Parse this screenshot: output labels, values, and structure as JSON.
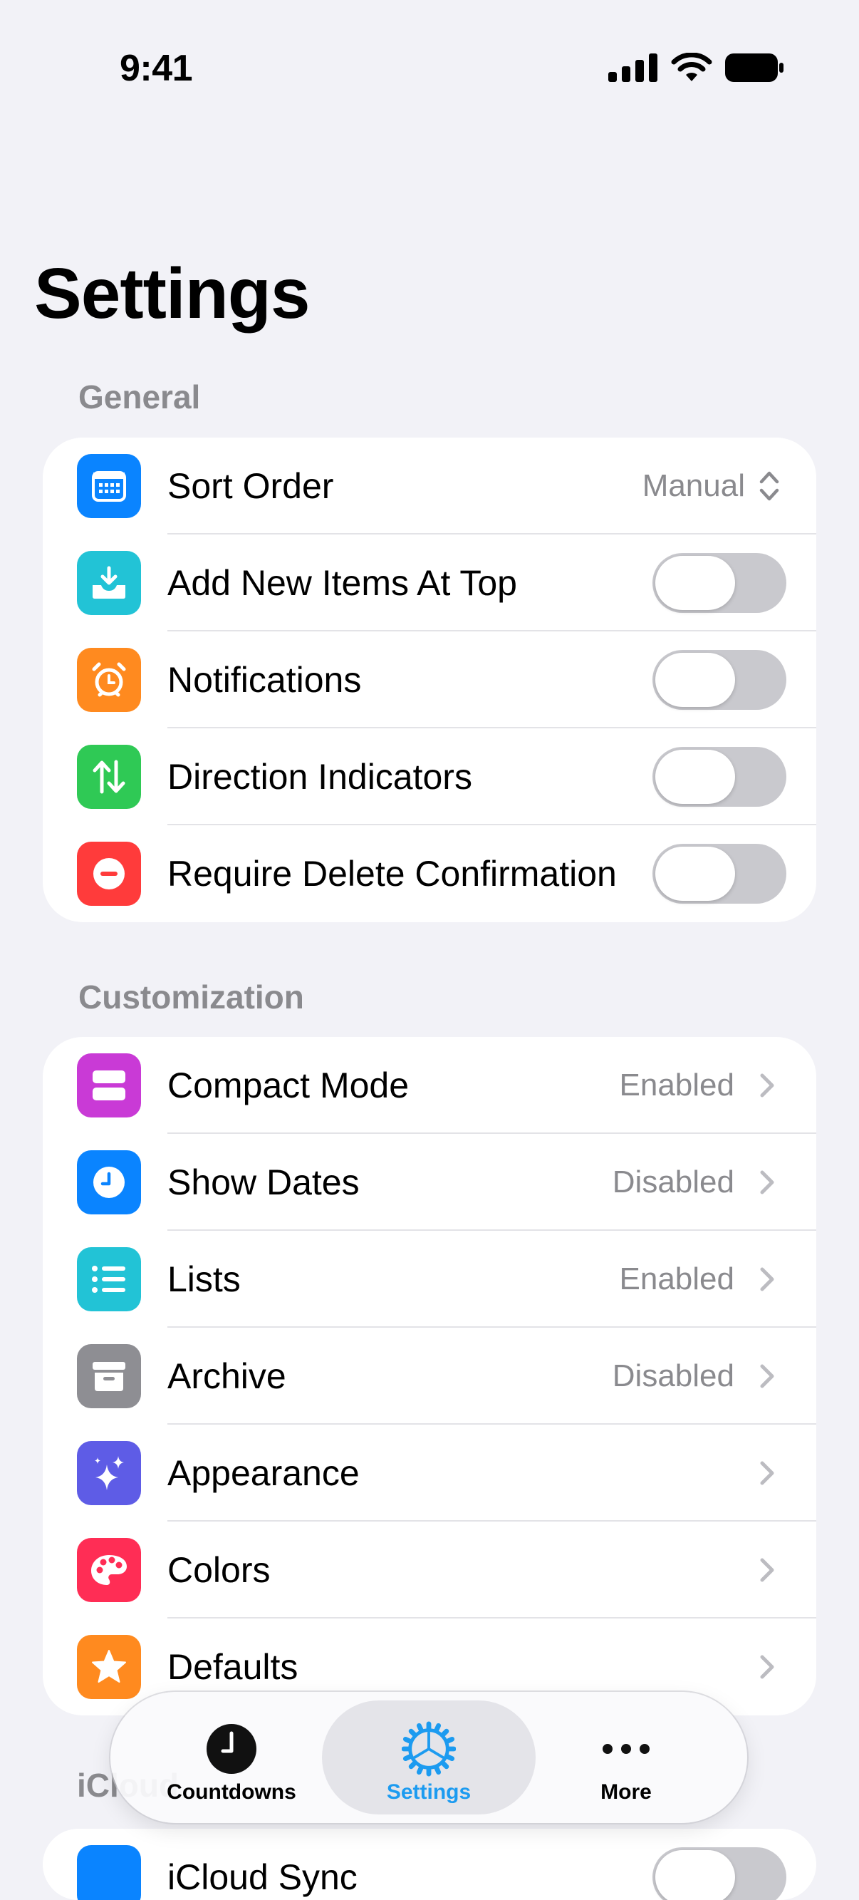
{
  "status_bar": {
    "time": "9:41"
  },
  "page": {
    "title": "Settings"
  },
  "sections": {
    "general": {
      "header": "General",
      "rows": [
        {
          "label": "Sort Order",
          "value": "Manual",
          "icon": "calendar-icon",
          "color": "#0a84ff"
        },
        {
          "label": "Add New Items At Top",
          "toggle": false,
          "icon": "inbox-download-icon",
          "color": "#22c3d6"
        },
        {
          "label": "Notifications",
          "toggle": false,
          "icon": "alarm-clock-icon",
          "color": "#ff8a1f"
        },
        {
          "label": "Direction Indicators",
          "toggle": false,
          "icon": "arrows-up-down-icon",
          "color": "#2fc955"
        },
        {
          "label": "Require Delete Confirmation",
          "toggle": false,
          "icon": "minus-circle-icon",
          "color": "#ff3b3b"
        }
      ]
    },
    "customization": {
      "header": "Customization",
      "rows": [
        {
          "label": "Compact Mode",
          "value": "Enabled",
          "icon": "rows-icon",
          "color": "#c93ad6"
        },
        {
          "label": "Show Dates",
          "value": "Disabled",
          "icon": "clock-icon",
          "color": "#0a84ff"
        },
        {
          "label": "Lists",
          "value": "Enabled",
          "icon": "list-icon",
          "color": "#22c3d6"
        },
        {
          "label": "Archive",
          "value": "Disabled",
          "icon": "archive-box-icon",
          "color": "#8e8e93"
        },
        {
          "label": "Appearance",
          "value": "",
          "icon": "sparkles-icon",
          "color": "#5e5ce6"
        },
        {
          "label": "Colors",
          "value": "",
          "icon": "palette-icon",
          "color": "#ff2d55"
        },
        {
          "label": "Defaults",
          "value": "",
          "icon": "star-icon",
          "color": "#ff8a1f"
        }
      ]
    },
    "icloud": {
      "header": "iCloud",
      "rows": [
        {
          "label": "iCloud Sync"
        }
      ]
    }
  },
  "tabbar": {
    "tabs": [
      {
        "label": "Countdowns",
        "icon": "clock-icon"
      },
      {
        "label": "Settings",
        "icon": "gear-icon",
        "active": true
      },
      {
        "label": "More",
        "icon": "ellipsis-icon"
      }
    ],
    "accent": "#1c9bf0"
  }
}
